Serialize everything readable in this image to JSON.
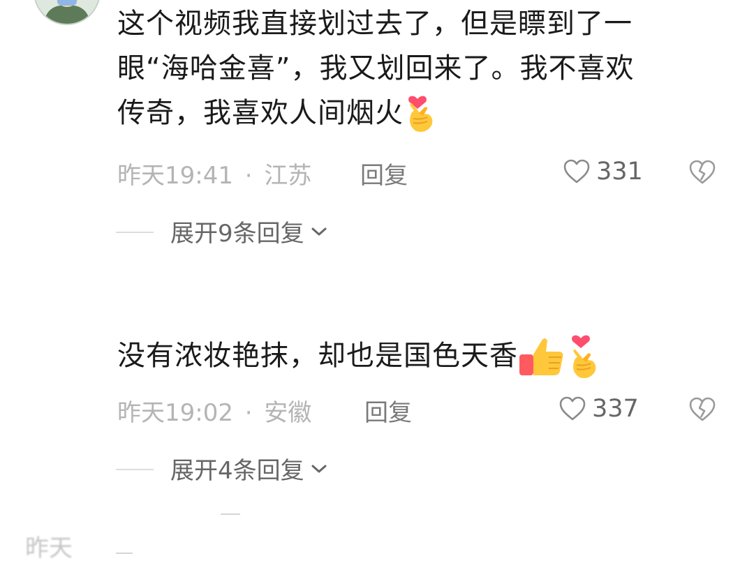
{
  "comments": [
    {
      "lines": [
        "这个视频我直接划过去了，但是瞟到了一",
        "眼“海哈金喜”，我又划回来了。我不喜欢",
        "传奇，我喜欢人间烟火"
      ],
      "emoji": [
        "finger-heart"
      ],
      "time": "昨天19:41",
      "location": "江苏",
      "reply_label": "回复",
      "likes": "331",
      "expand_label": "展开9条回复"
    },
    {
      "lines": [
        "没有浓妆艳抹，却也是国色天香"
      ],
      "emoji": [
        "thumbs-up",
        "finger-heart"
      ],
      "time": "昨天19:02",
      "location": "安徽",
      "reply_label": "回复",
      "likes": "337",
      "expand_label": "展开4条回复"
    }
  ],
  "meta_separator": "·",
  "partial_time": "昨天",
  "colors": {
    "text": "#1a1a1a",
    "meta": "#b4b4b4",
    "reply": "#7a7a7a",
    "count": "#666666"
  }
}
